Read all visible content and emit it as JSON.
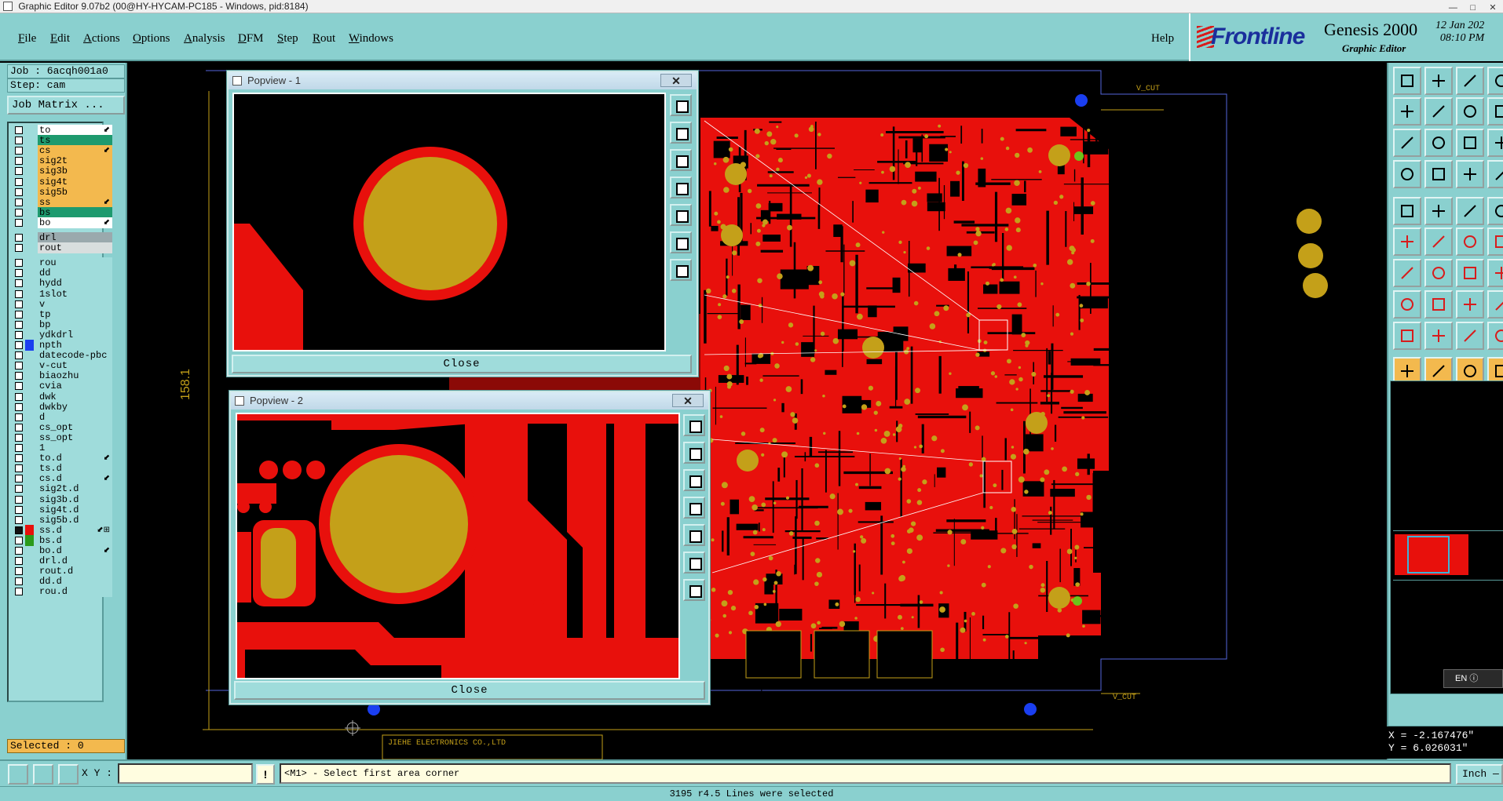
{
  "window": {
    "title": "Graphic Editor 9.07b2 (00@HY-HYCAM-PC185 - Windows, pid:8184)",
    "controls": [
      "—",
      "□",
      "✕"
    ]
  },
  "menu": {
    "items": [
      "File",
      "Edit",
      "Actions",
      "Options",
      "Analysis",
      "DFM",
      "Step",
      "Rout",
      "Windows"
    ],
    "help": "Help"
  },
  "brand": {
    "logo": "Frontline",
    "product": "Genesis 2000",
    "subtitle": "Graphic Editor",
    "date": "12 Jan 202",
    "time": "08:10 PM"
  },
  "job": {
    "job_label": "Job : 6acqh001a0",
    "step_label": "Step: cam",
    "matrix_button": "Job Matrix ..."
  },
  "layers": [
    {
      "name": "to",
      "color": "#ffffff",
      "mark": "⬋"
    },
    {
      "name": "ts",
      "color": "#1e9a6e",
      "mark": ""
    },
    {
      "name": "cs",
      "color": "#f3b94e",
      "mark": "⬋"
    },
    {
      "name": "sig2t",
      "color": "#f3b94e",
      "mark": ""
    },
    {
      "name": "sig3b",
      "color": "#f3b94e",
      "mark": ""
    },
    {
      "name": "sig4t",
      "color": "#f3b94e",
      "mark": ""
    },
    {
      "name": "sig5b",
      "color": "#f3b94e",
      "mark": ""
    },
    {
      "name": "ss",
      "color": "#f3b94e",
      "mark": "⬋"
    },
    {
      "name": "bs",
      "color": "#1e9a6e",
      "mark": ""
    },
    {
      "name": "bo",
      "color": "#ffffff",
      "mark": "⬋"
    },
    {
      "name": "drl",
      "color": "#9aa9ad",
      "mark": ""
    },
    {
      "name": "rout",
      "color": "#d8dede",
      "mark": ""
    },
    {
      "name": "rou",
      "color": "#9fdcdb",
      "mark": ""
    },
    {
      "name": "dd",
      "color": "#9fdcdb",
      "mark": ""
    },
    {
      "name": "hydd",
      "color": "#9fdcdb",
      "mark": ""
    },
    {
      "name": "1slot",
      "color": "#9fdcdb",
      "mark": ""
    },
    {
      "name": "v",
      "color": "#9fdcdb",
      "mark": ""
    },
    {
      "name": "tp",
      "color": "#9fdcdb",
      "mark": ""
    },
    {
      "name": "bp",
      "color": "#9fdcdb",
      "mark": ""
    },
    {
      "name": "ydkdrl",
      "color": "#9fdcdb",
      "mark": ""
    },
    {
      "name": "npth",
      "color": "#9fdcdb",
      "mark": "",
      "swatch": "#1a3ef0"
    },
    {
      "name": "datecode-pbc",
      "color": "#9fdcdb",
      "mark": ""
    },
    {
      "name": "v-cut",
      "color": "#9fdcdb",
      "mark": ""
    },
    {
      "name": "biaozhu",
      "color": "#9fdcdb",
      "mark": ""
    },
    {
      "name": "cvia",
      "color": "#9fdcdb",
      "mark": ""
    },
    {
      "name": "dwk",
      "color": "#9fdcdb",
      "mark": ""
    },
    {
      "name": "dwkby",
      "color": "#9fdcdb",
      "mark": ""
    },
    {
      "name": "d",
      "color": "#9fdcdb",
      "mark": ""
    },
    {
      "name": "cs_opt",
      "color": "#9fdcdb",
      "mark": ""
    },
    {
      "name": "ss_opt",
      "color": "#9fdcdb",
      "mark": ""
    },
    {
      "name": "1",
      "color": "#9fdcdb",
      "mark": ""
    },
    {
      "name": "to.d",
      "color": "#9fdcdb",
      "mark": "⬋"
    },
    {
      "name": "ts.d",
      "color": "#9fdcdb",
      "mark": ""
    },
    {
      "name": "cs.d",
      "color": "#9fdcdb",
      "mark": "⬋"
    },
    {
      "name": "sig2t.d",
      "color": "#9fdcdb",
      "mark": ""
    },
    {
      "name": "sig3b.d",
      "color": "#9fdcdb",
      "mark": ""
    },
    {
      "name": "sig4t.d",
      "color": "#9fdcdb",
      "mark": ""
    },
    {
      "name": "sig5b.d",
      "color": "#9fdcdb",
      "mark": ""
    },
    {
      "name": "ss.d",
      "color": "#9fdcdb",
      "mark": "⬋⊞",
      "swatch": "#e8100c",
      "checked": true
    },
    {
      "name": "bs.d",
      "color": "#9fdcdb",
      "mark": "",
      "swatch": "#2a9a1a"
    },
    {
      "name": "bo.d",
      "color": "#9fdcdb",
      "mark": "⬋"
    },
    {
      "name": "drl.d",
      "color": "#9fdcdb",
      "mark": ""
    },
    {
      "name": "rout.d",
      "color": "#9fdcdb",
      "mark": ""
    },
    {
      "name": "dd.d",
      "color": "#9fdcdb",
      "mark": ""
    },
    {
      "name": "rou.d",
      "color": "#9fdcdb",
      "mark": ""
    }
  ],
  "selected_label": "Selected : 0",
  "canvas": {
    "dimension_label": "158.1",
    "vcut_label_top": "V_CUT",
    "vcut_label_bottom": "V_CUT",
    "silk_text_line1": "JIEHE ELECTRONICS CO.,LTD",
    "colors": {
      "copper": "#e8100c",
      "pad": "#c4a019",
      "background": "#000000",
      "outline": "#5566dd"
    }
  },
  "popview1": {
    "title": "Popview - 1",
    "close_x": "✕",
    "close_button": "Close"
  },
  "popview2": {
    "title": "Popview - 2",
    "close_x": "✕",
    "close_button": "Close"
  },
  "right_panel": {
    "en_indicator": "EN",
    "coord_x": "X = -2.167476\"",
    "coord_y": "Y = 6.026031\""
  },
  "command": {
    "xy_label": "X Y :",
    "xy_value": "",
    "info_glyph": "!",
    "prompt": "<M1> - Select first area corner",
    "unit": "Inch —"
  },
  "status": {
    "message": "3195 r4.5 Lines were selected"
  }
}
